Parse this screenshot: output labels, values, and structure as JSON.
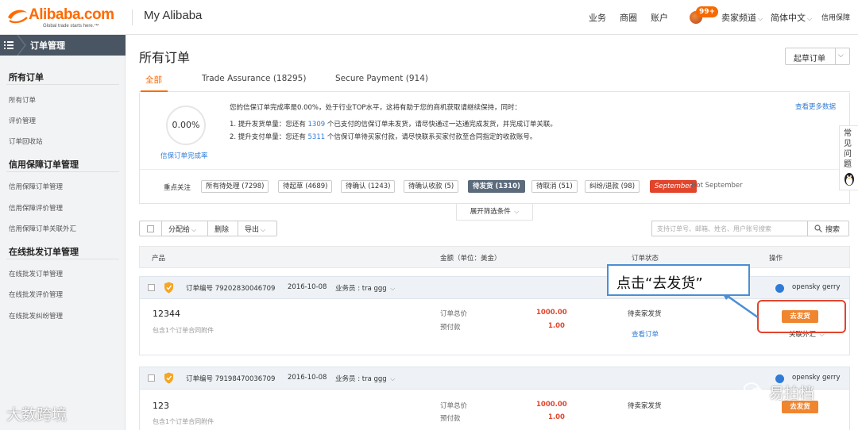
{
  "header": {
    "logo_text": "Alibaba.com",
    "logo_tagline": "Global trade starts here.™",
    "title": "My Alibaba",
    "nav": [
      "业务",
      "商圈",
      "账户"
    ],
    "notification_count": "99+",
    "seller_channel": "卖家频道",
    "language": "简体中文",
    "trade_assurance": "信用保障"
  },
  "sidebar": {
    "header": "订单管理",
    "sections": [
      {
        "title": "所有订单",
        "items": [
          "所有订单",
          "评价管理",
          "订单回收站"
        ]
      },
      {
        "title": "信用保障订单管理",
        "items": [
          "信用保障订单管理",
          "信用保障评价管理",
          "信用保障订单关联外汇"
        ]
      },
      {
        "title": "在线批发订单管理",
        "items": [
          "在线批发订单管理",
          "在线批发评价管理",
          "在线批发纠纷管理"
        ]
      }
    ]
  },
  "main": {
    "title": "所有订单",
    "draft_button": "起草订单",
    "tabs": [
      "全部",
      "Trade Assurance (18295)",
      "Secure Payment (914)"
    ],
    "active_tab": 0,
    "stats": {
      "completion_rate": "0.00%",
      "completion_label": "信保订单完成率",
      "message_line1": "您的信保订单完成率是0.00%，处于行业TOP水平，这将有助于您的商机获取请继续保持，同时：",
      "message_line2_prefix": "1. 提升发货单量：您还有 ",
      "message_line2_num": "1309",
      "message_line2_suffix": " 个已支付的信保订单未发货，请尽快通过一达通完成发货，并完成订单关联。",
      "message_line3_prefix": "2. 提升支付单量：您还有 ",
      "message_line3_num": "5311",
      "message_line3_suffix": " 个信保订单待买家付款，请尽快联系买家付款至合同指定的收款账号。",
      "more_data": "查看更多数据"
    },
    "focus": {
      "label": "重点关注",
      "chips": [
        "所有待处理 (7298)",
        "待起草 (4689)",
        "待确认 (1243)",
        "待确认收款 (5)",
        "待发货 (1310)",
        "待取消 (51)",
        "纠纷/退款 (98)"
      ],
      "active_chip": 4,
      "promo_chip": "September",
      "promo_text": "Hot September"
    },
    "filter_toggle": "展开筛选条件",
    "toolbar": {
      "assign": "分配给",
      "delete": "删除",
      "export": "导出"
    },
    "search": {
      "placeholder": "支持订单号、邮箱、姓名、用户账号搜索",
      "button": "搜索"
    },
    "columns": [
      "产品",
      "金额（单位：美金）",
      "订单状态",
      "操作"
    ],
    "orders": [
      {
        "order_no": "订单编号 79202830046709",
        "date": "2016-10-08",
        "salesperson": "业务员 : tra ggg",
        "seller": "opensky gerry",
        "product": "12344",
        "product_note": "包含1个订单合同附件",
        "total_label": "订单总价",
        "total": "1000.00",
        "prepay_label": "预付款",
        "prepay": "1.00",
        "status": "待卖家发货",
        "view_order": "查看订单",
        "action": "去发货",
        "link_fx": "关联外汇"
      },
      {
        "order_no": "订单编号 79198470036709",
        "date": "2016-10-08",
        "salesperson": "业务员 : tra ggg",
        "seller": "opensky gerry",
        "product": "123",
        "product_note": "包含1个订单合同附件",
        "total_label": "订单总价",
        "total": "1000.00",
        "prepay_label": "预付款",
        "prepay": "1.00",
        "status": "待卖家发货",
        "action": "去发货"
      }
    ]
  },
  "callout": {
    "text": "点击“去发货”"
  },
  "side_widget": {
    "text": "常见问题"
  },
  "watermarks": {
    "left": "大数跨境",
    "right": "易拍档"
  },
  "colors": {
    "brand": "#ff6a00",
    "link": "#2f7bd5",
    "price": "#e2452c",
    "action": "#f0852f",
    "callout_border": "#4a8fd6"
  }
}
